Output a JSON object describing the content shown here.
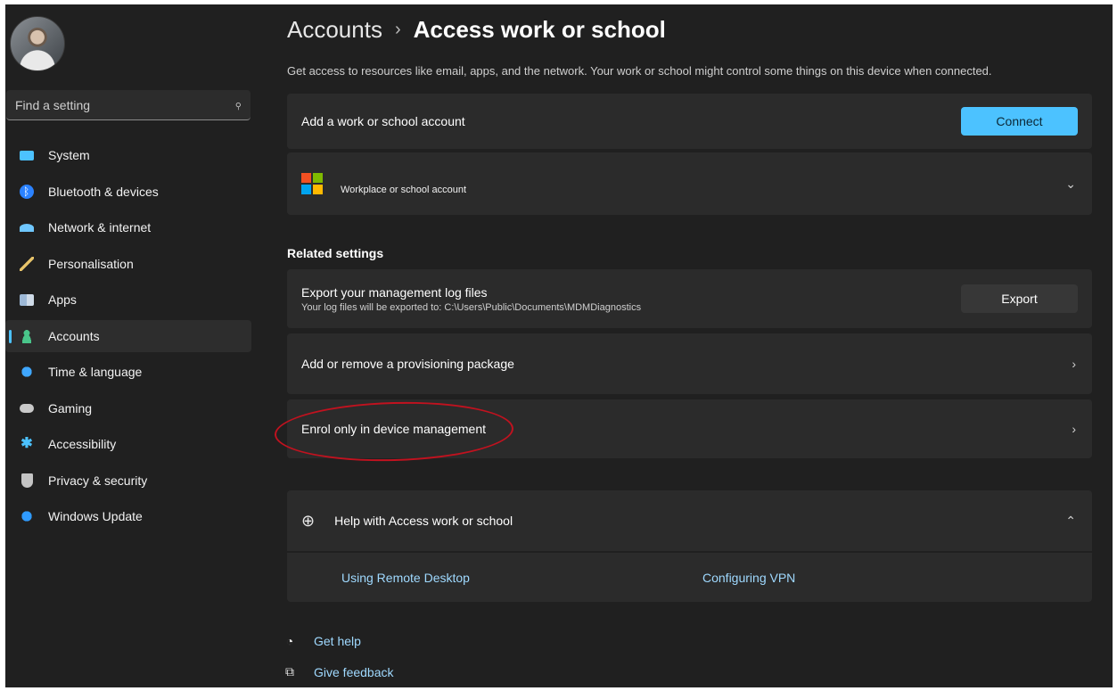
{
  "search": {
    "placeholder": "Find a setting"
  },
  "nav": [
    {
      "label": "System",
      "icon": "system-icon"
    },
    {
      "label": "Bluetooth & devices",
      "icon": "bluetooth-icon"
    },
    {
      "label": "Network & internet",
      "icon": "wifi-icon"
    },
    {
      "label": "Personalisation",
      "icon": "brush-icon"
    },
    {
      "label": "Apps",
      "icon": "apps-icon"
    },
    {
      "label": "Accounts",
      "icon": "person-icon",
      "selected": true
    },
    {
      "label": "Time & language",
      "icon": "globe-clock-icon"
    },
    {
      "label": "Gaming",
      "icon": "controller-icon"
    },
    {
      "label": "Accessibility",
      "icon": "accessibility-icon"
    },
    {
      "label": "Privacy & security",
      "icon": "shield-icon"
    },
    {
      "label": "Windows Update",
      "icon": "update-icon"
    }
  ],
  "header": {
    "parent": "Accounts",
    "separator": "›",
    "current": "Access work or school",
    "description": "Get access to resources like email, apps, and the network. Your work or school might control some things on this device when connected."
  },
  "add_account": {
    "label": "Add a work or school account",
    "button": "Connect"
  },
  "workplace": {
    "label": "Workplace or school account",
    "chevron": "⌄"
  },
  "related": {
    "heading": "Related settings",
    "export": {
      "label": "Export your management log files",
      "sub": "Your log files will be exported to: C:\\Users\\Public\\Documents\\MDMDiagnostics",
      "button": "Export"
    },
    "provisioning": {
      "label": "Add or remove a provisioning package",
      "chevron": "›"
    },
    "enrol": {
      "label": "Enrol only in device management",
      "chevron": "›"
    }
  },
  "help": {
    "title": "Help with Access work or school",
    "chevron": "⌃",
    "links": [
      "Using Remote Desktop",
      "Configuring VPN"
    ]
  },
  "footer": {
    "get_help": "Get help",
    "give_feedback": "Give feedback"
  },
  "colors": {
    "accent": "#4cc2ff",
    "background": "#202020",
    "card": "#2b2b2b",
    "annotation": "#c1121f"
  }
}
